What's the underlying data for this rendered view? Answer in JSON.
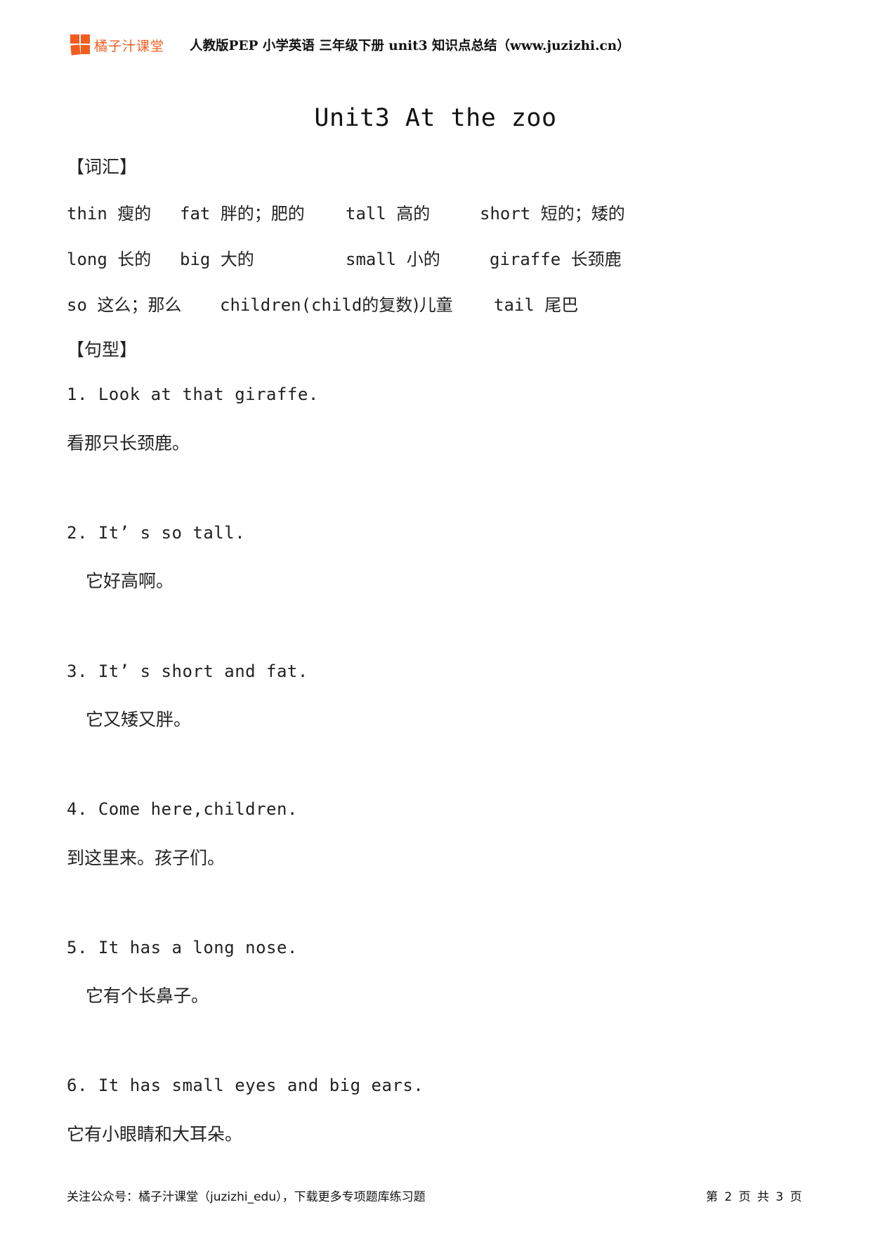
{
  "header": {
    "logo_text": "橘子汁课堂",
    "title": "人教版PEP 小学英语 三年级下册  unit3 知识点总结（www.juzizhi.cn）",
    "brand_color": "#f25c1f"
  },
  "document": {
    "title": "Unit3 At the zoo",
    "vocab_heading": "【词汇】",
    "vocab_rows": [
      [
        {
          "en": "thin",
          "cn": "瘦的"
        },
        {
          "en": "fat",
          "cn": "胖的；肥的"
        },
        {
          "en": "tall",
          "cn": "高的"
        },
        {
          "en": "short",
          "cn": "短的；矮的"
        }
      ],
      [
        {
          "en": "long",
          "cn": "长的"
        },
        {
          "en": "big",
          "cn": "大的"
        },
        {
          "en": "small",
          "cn": "小的"
        },
        {
          "en": "giraffe",
          "cn": "长颈鹿"
        }
      ],
      [
        {
          "en": "so",
          "cn": "这么；那么"
        },
        {
          "en": "children(child",
          "cn": "的复数)儿童"
        },
        {
          "en": "tail",
          "cn": "尾巴"
        }
      ]
    ],
    "sentence_heading": "【句型】",
    "sentences": [
      {
        "en": "1.  Look at that giraffe.",
        "zh": "看那只长颈鹿。"
      },
      {
        "en": "2.  It’ s so tall.",
        "zh": "它好高啊。"
      },
      {
        "en": "3.  It’ s short and fat.",
        "zh": "它又矮又胖。"
      },
      {
        "en": "4.  Come here,children.",
        "zh": "到这里来。孩子们。"
      },
      {
        "en": "5.  It has a long nose.",
        "zh": "它有个长鼻子。"
      },
      {
        "en": "6.  It has small eyes and big ears.",
        "zh": "它有小眼睛和大耳朵。"
      }
    ]
  },
  "footer": {
    "left": "关注公众号：橘子汁课堂（juzizhi_edu），下载更多专项题库练习题",
    "page_label": "第 2 页 共 3 页"
  }
}
